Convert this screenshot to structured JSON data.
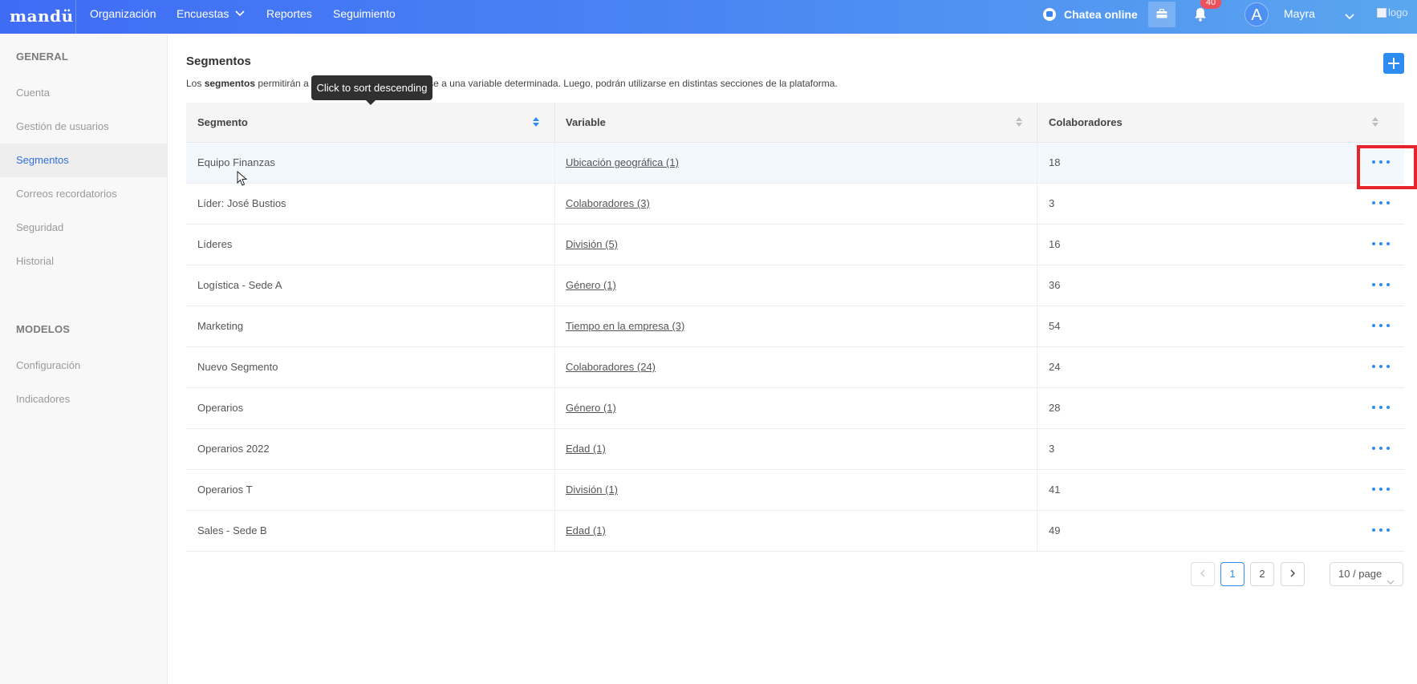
{
  "topbar": {
    "brand": "mandü",
    "nav": [
      {
        "label": "Organización"
      },
      {
        "label": "Encuestas",
        "has_dropdown": true
      },
      {
        "label": "Reportes"
      },
      {
        "label": "Seguimiento"
      }
    ],
    "chat_label": "Chatea online",
    "notification_count": "40",
    "avatar_letter": "A",
    "user_name": "Mayra",
    "logo_alt": "logo"
  },
  "sidebar": {
    "sections": [
      {
        "heading": "GENERAL",
        "items": [
          {
            "label": "Cuenta",
            "active": false
          },
          {
            "label": "Gestión de usuarios",
            "active": false
          },
          {
            "label": "Segmentos",
            "active": true
          },
          {
            "label": "Correos recordatorios",
            "active": false
          },
          {
            "label": "Seguridad",
            "active": false
          },
          {
            "label": "Historial",
            "active": false
          }
        ]
      },
      {
        "heading": "MODELOS",
        "items": [
          {
            "label": "Configuración",
            "active": false
          },
          {
            "label": "Indicadores",
            "active": false
          }
        ]
      }
    ]
  },
  "main": {
    "title": "Segmentos",
    "description_prefix": "Los ",
    "description_bold": "segmentos",
    "description_rest": " permitirán a            colaboradores en base a una variable determinada. Luego, podrán utilizarse en distintas secciones de la plataforma.",
    "tooltip": "Click to sort descending"
  },
  "table": {
    "columns": [
      "Segmento",
      "Variable",
      "Colaboradores"
    ],
    "rows": [
      {
        "segmento": "Equipo Finanzas",
        "variable": "Ubicación geográfica (1)",
        "colaboradores": "18"
      },
      {
        "segmento": "Líder: José Bustios",
        "variable": "Colaboradores (3)",
        "colaboradores": "3"
      },
      {
        "segmento": "Líderes",
        "variable": "División (5)",
        "colaboradores": "16"
      },
      {
        "segmento": "Logística - Sede A",
        "variable": "Género (1)",
        "colaboradores": "36"
      },
      {
        "segmento": "Marketing",
        "variable": "Tiempo en la empresa (3)",
        "colaboradores": "54"
      },
      {
        "segmento": "Nuevo Segmento",
        "variable": "Colaboradores (24)",
        "colaboradores": "24"
      },
      {
        "segmento": "Operarios",
        "variable": "Género (1)",
        "colaboradores": "28"
      },
      {
        "segmento": "Operarios 2022",
        "variable": "Edad (1)",
        "colaboradores": "3"
      },
      {
        "segmento": "Operarios T",
        "variable": "División (1)",
        "colaboradores": "41"
      },
      {
        "segmento": "Sales - Sede B",
        "variable": "Edad (1)",
        "colaboradores": "49"
      }
    ]
  },
  "pagination": {
    "pages": [
      "1",
      "2"
    ],
    "current_page": "1",
    "page_size": "10 / page"
  },
  "colors": {
    "accent": "#2d8cf0",
    "highlight": "#e8232a",
    "badge": "#f0505a"
  }
}
